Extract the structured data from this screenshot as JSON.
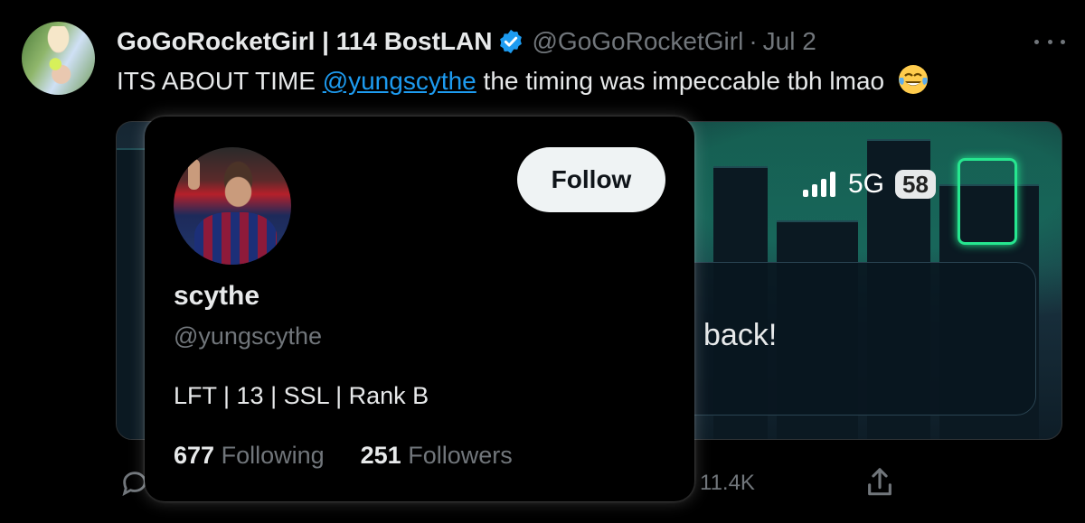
{
  "tweet": {
    "author_name": "GoGoRocketGirl | 114 BostLAN",
    "author_handle": "@GoGoRocketGirl",
    "separator": "·",
    "date": "Jul 2",
    "text_before": "ITS ABOUT TIME ",
    "mention": "@yungscythe",
    "text_after": " the timing was impeccable tbh lmao",
    "emoji": "face-with-tears-of-joy",
    "views": "11.4K"
  },
  "media": {
    "status_network": "5G",
    "status_battery": "58",
    "card_text": "back!"
  },
  "hovercard": {
    "follow_label": "Follow",
    "name": "scythe",
    "handle": "@yungscythe",
    "bio": "LFT | 13 | SSL | Rank B",
    "following_count": "677",
    "following_label": "Following",
    "followers_count": "251",
    "followers_label": "Followers"
  },
  "colors": {
    "background": "#000000",
    "text": "#e7e9ea",
    "muted": "#71767b",
    "link": "#1d9bf0",
    "verified": "#1d9bf0",
    "follow_button_bg": "#eff3f4"
  },
  "icons": [
    "verified-badge-icon",
    "more-icon",
    "reply-icon",
    "share-icon",
    "signal-icon"
  ]
}
